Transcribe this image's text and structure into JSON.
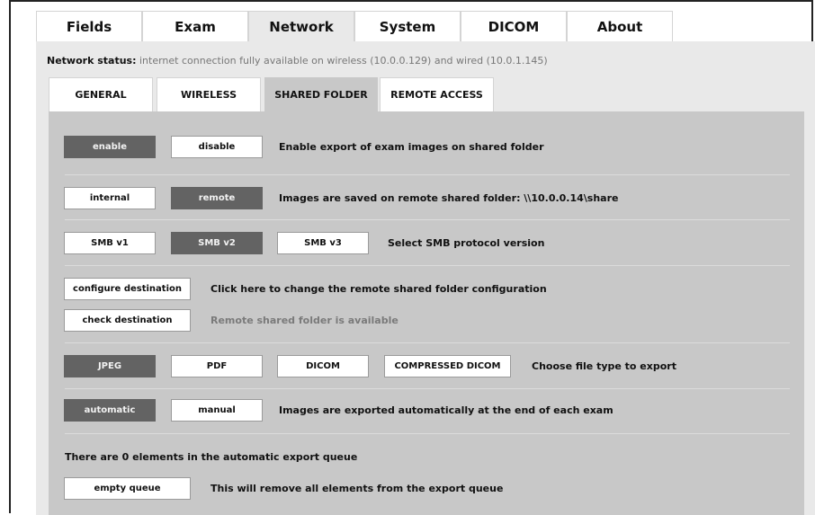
{
  "main_tabs": [
    {
      "label": "Fields"
    },
    {
      "label": "Exam"
    },
    {
      "label": "Network",
      "active": true
    },
    {
      "label": "System"
    },
    {
      "label": "DICOM"
    },
    {
      "label": "About"
    }
  ],
  "network_status": {
    "label": "Network status:",
    "text": "internet connection fully available on wireless (10.0.0.129) and wired (10.0.1.145)"
  },
  "sub_tabs": [
    {
      "label": "GENERAL"
    },
    {
      "label": "WIRELESS"
    },
    {
      "label": "SHARED FOLDER",
      "active": true
    },
    {
      "label": "REMOTE ACCESS"
    }
  ],
  "shared_folder": {
    "export": {
      "enable_label": "enable",
      "disable_label": "disable",
      "selected": "enable",
      "description": "Enable export of exam images on shared folder"
    },
    "location": {
      "internal_label": "internal",
      "remote_label": "remote",
      "selected": "remote",
      "description": "Images are saved on remote shared folder: \\\\10.0.0.14\\share"
    },
    "smb": {
      "v1_label": "SMB v1",
      "v2_label": "SMB v2",
      "v3_label": "SMB v3",
      "selected": "SMB v2",
      "description": "Select SMB protocol version"
    },
    "destination": {
      "configure_label": "configure destination",
      "configure_description": "Click here to change the remote shared folder configuration",
      "check_label": "check destination",
      "check_status": "Remote shared folder is available"
    },
    "file_type": {
      "jpeg_label": "JPEG",
      "pdf_label": "PDF",
      "dicom_label": "DICOM",
      "compressed_dicom_label": "COMPRESSED DICOM",
      "selected": "JPEG",
      "description": "Choose file type to export"
    },
    "mode": {
      "automatic_label": "automatic",
      "manual_label": "manual",
      "selected": "automatic",
      "description": "Images are exported automatically at the end of each exam"
    },
    "queue": {
      "count_text": "There are 0 elements in the automatic export queue",
      "empty_label": "empty queue",
      "empty_description": "This will remove all elements from the export queue"
    }
  },
  "colors": {
    "selected_button": "#636363",
    "panel_bg": "#e9e9e9",
    "content_bg": "#c8c8c8"
  }
}
